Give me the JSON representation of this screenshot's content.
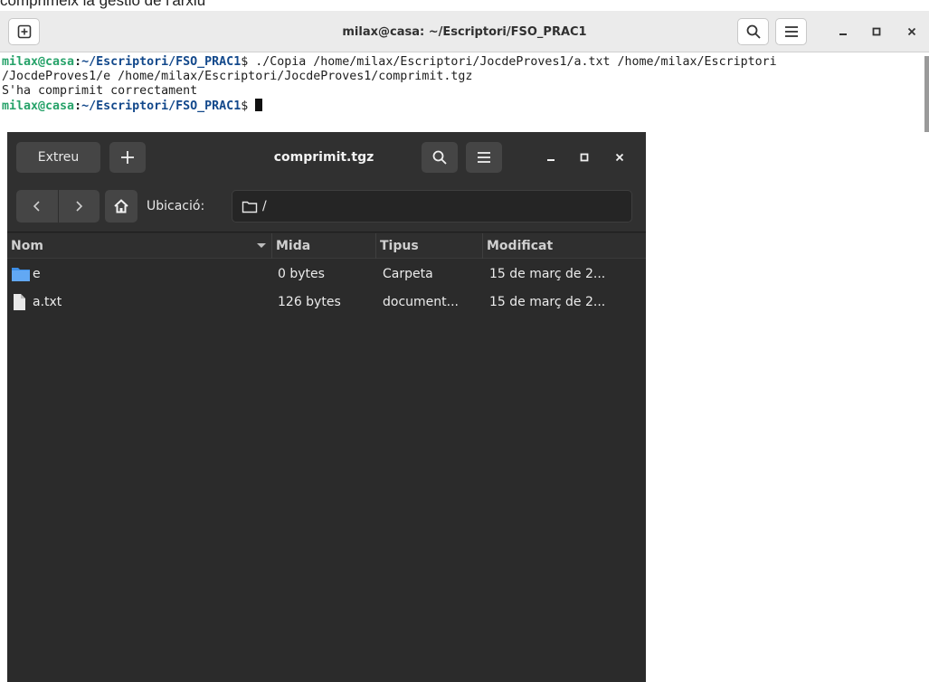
{
  "doc": {
    "top_text": "comprimeix la gestió de l'arxiu"
  },
  "terminal": {
    "title": "milax@casa: ~/Escriptori/FSO_PRAC1",
    "prompt_user": "milax@casa",
    "prompt_colon": ":",
    "prompt_path": "~/Escriptori/FSO_PRAC1",
    "prompt_symbol": "$ ",
    "command_line_1": "./Copia /home/milax/Escriptori/JocdeProves1/a.txt /home/milax/Escriptori",
    "command_line_2": "/JocdeProves1/e /home/milax/Escriptori/JocdeProves1/comprimit.tgz",
    "output_line": "S'ha comprimit correctament"
  },
  "archive": {
    "extract_label": "Extreu",
    "title": "comprimit.tgz",
    "location_label": "Ubicació:",
    "location_path": "/",
    "columns": {
      "name": "Nom",
      "size": "Mida",
      "type": "Tipus",
      "modified": "Modificat"
    },
    "rows": [
      {
        "icon": "folder-icon",
        "name": "e",
        "size": "0 bytes",
        "type": "Carpeta",
        "modified": "15 de març de 2..."
      },
      {
        "icon": "text-file-icon",
        "name": "a.txt",
        "size": "126 bytes",
        "type": "document...",
        "modified": "15 de març de 2..."
      }
    ]
  }
}
